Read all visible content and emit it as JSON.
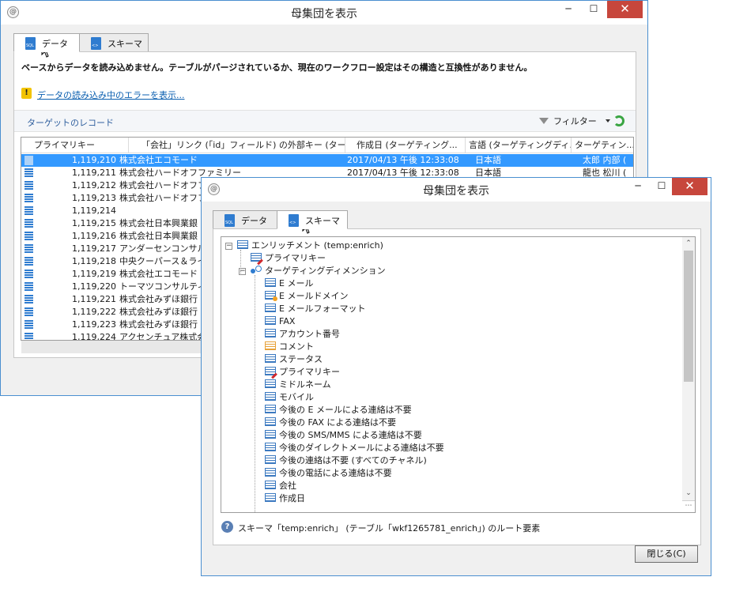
{
  "colors": {
    "accent": "#3399ff",
    "title_border": "#4a8fd0",
    "close": "#c7463c",
    "refresh": "#3aa543",
    "link": "#0b5fb0"
  },
  "window1": {
    "title": "母集団を表示",
    "icon": "app-icon",
    "controls": {
      "minimize": "─",
      "maximize": "☐",
      "close": "✕"
    },
    "tabs": [
      {
        "label": "データ",
        "icon": "sql-doc-icon",
        "icon_text": "SQL"
      },
      {
        "label": "スキーマ",
        "icon": "xml-doc-icon",
        "icon_text": "<>"
      }
    ],
    "error_message": "ベースからデータを読み込めません。テーブルがパージされているか、現在のワークフロー設定はその構造と互換性がありません。",
    "error_link": "データの読み込み中のエラーを表示...",
    "records_label": "ターゲットのレコード",
    "filter_label": "フィルター",
    "columns": [
      "プライマリキー",
      "「会社」リンク (「id」フィールド) の外部キー (ター...",
      "作成日 (ターゲティング...",
      "言語 (ターゲティングディ...",
      "ターゲティン..."
    ],
    "rows": [
      {
        "key": "1,119,210",
        "company": "株式会社エコモード",
        "created": "2017/04/13 午後 12:33:08",
        "lang": "日本語",
        "name": "太郎 内部 (",
        "selected": true
      },
      {
        "key": "1,119,211",
        "company": "株式会社ハードオフファミリー",
        "created": "2017/04/13 午後 12:33:08",
        "lang": "日本語",
        "name": "龍也 松川 ("
      },
      {
        "key": "1,119,212",
        "company": "株式会社ハードオフフ",
        "created": "",
        "lang": "",
        "name": ""
      },
      {
        "key": "1,119,213",
        "company": "株式会社ハードオフフ",
        "created": "",
        "lang": "",
        "name": ""
      },
      {
        "key": "1,119,214",
        "company": "",
        "created": "",
        "lang": "",
        "name": ""
      },
      {
        "key": "1,119,215",
        "company": "株式会社日本興業銀",
        "created": "",
        "lang": "",
        "name": ""
      },
      {
        "key": "1,119,216",
        "company": "株式会社日本興業銀",
        "created": "",
        "lang": "",
        "name": ""
      },
      {
        "key": "1,119,217",
        "company": "アンダーセンコンサルテ",
        "created": "",
        "lang": "",
        "name": ""
      },
      {
        "key": "1,119,218",
        "company": "中央クーパース＆ライ",
        "created": "",
        "lang": "",
        "name": ""
      },
      {
        "key": "1,119,219",
        "company": "株式会社エコモード",
        "created": "",
        "lang": "",
        "name": ""
      },
      {
        "key": "1,119,220",
        "company": "トーマツコンサルティン",
        "created": "",
        "lang": "",
        "name": ""
      },
      {
        "key": "1,119,221",
        "company": "株式会社みずほ銀行",
        "created": "",
        "lang": "",
        "name": ""
      },
      {
        "key": "1,119,222",
        "company": "株式会社みずほ銀行",
        "created": "",
        "lang": "",
        "name": ""
      },
      {
        "key": "1,119,223",
        "company": "株式会社みずほ銀行",
        "created": "",
        "lang": "",
        "name": ""
      },
      {
        "key": "1,119,224",
        "company": "アクセンチュア株式会",
        "created": "",
        "lang": "",
        "name": ""
      }
    ]
  },
  "window2": {
    "title": "母集団を表示",
    "icon": "app-icon",
    "controls": {
      "minimize": "─",
      "maximize": "☐",
      "close": "✕"
    },
    "tabs": [
      {
        "label": "データ",
        "icon": "sql-doc-icon",
        "icon_text": "SQL"
      },
      {
        "label": "スキーマ",
        "icon": "xml-doc-icon",
        "icon_text": "<>"
      }
    ],
    "tree": [
      {
        "label": "エンリッチメント (temp:enrich)",
        "icon": "collection-icon",
        "level": 0,
        "expander": "−"
      },
      {
        "label": "プライマリキー",
        "icon": "primary-key-icon",
        "level": 1
      },
      {
        "label": "ターゲティングディメンション",
        "icon": "link-icon",
        "level": 1,
        "expander": "−"
      },
      {
        "label": "E メール",
        "icon": "field-icon",
        "level": 2
      },
      {
        "label": "E メールドメイン",
        "icon": "indexed-field-icon",
        "level": 2
      },
      {
        "label": "E メールフォーマット",
        "icon": "field-icon",
        "level": 2
      },
      {
        "label": "FAX",
        "icon": "field-icon",
        "level": 2
      },
      {
        "label": "アカウント番号",
        "icon": "field-icon",
        "level": 2
      },
      {
        "label": "コメント",
        "icon": "memo-field-icon",
        "level": 2
      },
      {
        "label": "ステータス",
        "icon": "field-icon",
        "level": 2
      },
      {
        "label": "プライマリキー",
        "icon": "primary-key-icon",
        "level": 2
      },
      {
        "label": "ミドルネーム",
        "icon": "field-icon",
        "level": 2
      },
      {
        "label": "モバイル",
        "icon": "field-icon",
        "level": 2
      },
      {
        "label": "今後の E メールによる連絡は不要",
        "icon": "field-icon",
        "level": 2
      },
      {
        "label": "今後の FAX による連絡は不要",
        "icon": "field-icon",
        "level": 2
      },
      {
        "label": "今後の SMS/MMS による連絡は不要",
        "icon": "field-icon",
        "level": 2
      },
      {
        "label": "今後のダイレクトメールによる連絡は不要",
        "icon": "field-icon",
        "level": 2
      },
      {
        "label": "今後の連絡は不要 (すべてのチャネル)",
        "icon": "field-icon",
        "level": 2
      },
      {
        "label": "今後の電話による連絡は不要",
        "icon": "field-icon",
        "level": 2
      },
      {
        "label": "会社",
        "icon": "field-icon",
        "level": 2
      },
      {
        "label": "作成日",
        "icon": "field-icon",
        "level": 2
      }
    ],
    "status_text": "スキーマ「temp:enrich」 (テーブル「wkf1265781_enrich」) のルート要素",
    "status_icon": "help-icon",
    "close_button": "閉じる(C)"
  }
}
